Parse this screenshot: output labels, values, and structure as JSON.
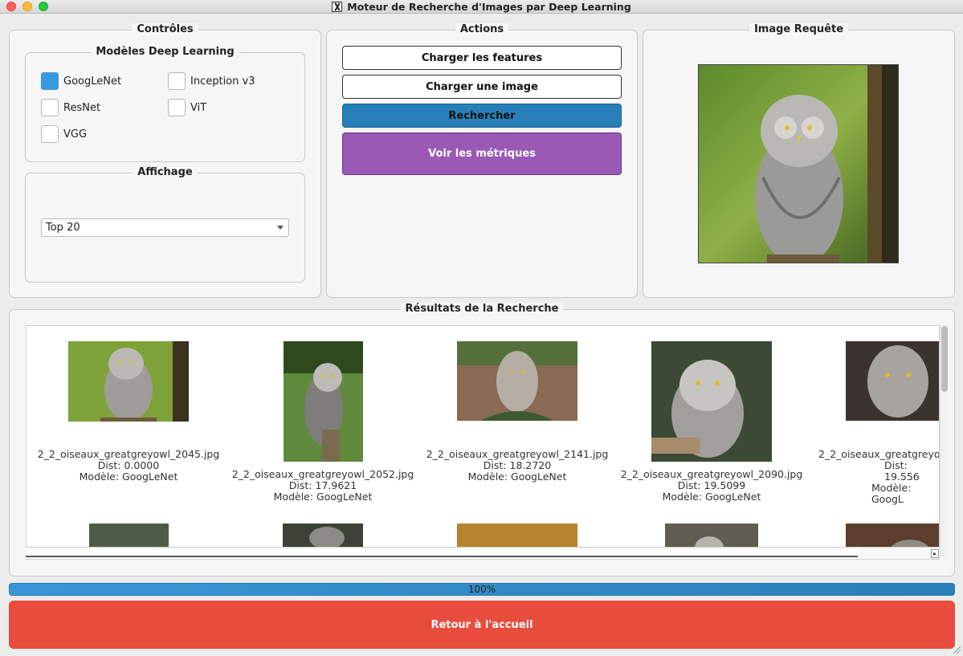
{
  "window": {
    "title": "Moteur de Recherche d'Images par Deep Learning"
  },
  "controls": {
    "title": "Contrôles",
    "models_group": {
      "title": "Modèles Deep Learning",
      "items": [
        {
          "label": "GoogLeNet",
          "checked": true
        },
        {
          "label": "Inception v3",
          "checked": false
        },
        {
          "label": "ResNet",
          "checked": false
        },
        {
          "label": "ViT",
          "checked": false
        },
        {
          "label": "VGG",
          "checked": false
        }
      ]
    },
    "display_group": {
      "title": "Affichage",
      "selected": "Top 20"
    }
  },
  "actions": {
    "title": "Actions",
    "load_features": "Charger les features",
    "load_image": "Charger une image",
    "search": "Rechercher",
    "metrics": "Voir les métriques"
  },
  "query": {
    "title": "Image Requête"
  },
  "results": {
    "title": "Résultats de la Recherche",
    "items": [
      {
        "file": "2_2_oiseaux_greatgreyowl_2045.jpg",
        "dist": "Dist: 0.0000",
        "model": "Modèle: GoogLeNet"
      },
      {
        "file": "2_2_oiseaux_greatgreyowl_2052.jpg",
        "dist": "Dist: 17.9621",
        "model": "Modèle: GoogLeNet"
      },
      {
        "file": "2_2_oiseaux_greatgreyowl_2141.jpg",
        "dist": "Dist: 18.2720",
        "model": "Modèle: GoogLeNet"
      },
      {
        "file": "2_2_oiseaux_greatgreyowl_2090.jpg",
        "dist": "Dist: 19.5099",
        "model": "Modèle: GoogLeNet"
      },
      {
        "file": "2_2_oiseaux_greatgreyo",
        "dist": "Dist: 19.556",
        "model": "Modèle: GoogL"
      }
    ]
  },
  "progress": {
    "value": 1.0,
    "label": "100%"
  },
  "home_button": "Retour à l'accueil",
  "colors": {
    "accent_blue": "#2980b9",
    "purple": "#9b59b6",
    "red": "#e74c3c",
    "checkbox_checked": "#3a9ae0"
  }
}
